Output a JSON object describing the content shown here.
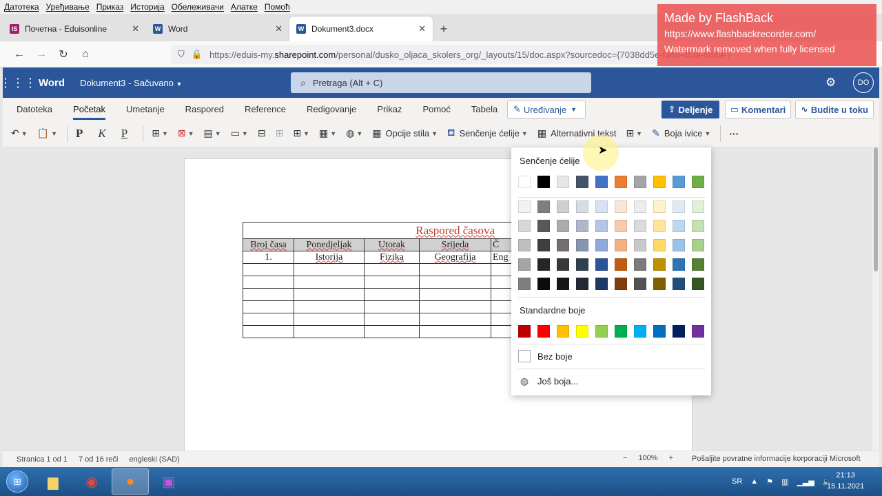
{
  "menubar": [
    "Датотека",
    "Уређивање",
    "Приказ",
    "Историја",
    "Обележивачи",
    "Алатке",
    "Помоћ"
  ],
  "tabs": [
    {
      "label": "Почетна - Eduisonline",
      "icon": "IS",
      "color": "#a0206e"
    },
    {
      "label": "Word",
      "icon": "W",
      "color": "#2b579a"
    },
    {
      "label": "Dokument3.docx",
      "icon": "W",
      "color": "#2b579a"
    }
  ],
  "url": {
    "prefix": "https://eduis-my.",
    "host": "sharepoint.com",
    "path": "/personal/dusko_oljaca_skolers_org/_layouts/15/doc.aspx?sourcedoc={7038dd5e-f348-4f39-8849-7"
  },
  "watermark": {
    "line1": "Made by FlashBack",
    "line2": "https://www.flashbackrecorder.com/",
    "line3": "Watermark removed when fully licensed"
  },
  "word": {
    "app": "Word",
    "doc": "Dokument3 - Sačuvano",
    "search_placeholder": "Pretraga (Alt + C)",
    "avatar": "DO"
  },
  "ribbon": {
    "tabs": [
      "Datoteka",
      "Početak",
      "Umetanje",
      "Raspored",
      "Reference",
      "Redigovanje",
      "Prikaz",
      "Pomoć",
      "Tabela"
    ],
    "edit": "Uređivanje",
    "share": "Deljenje",
    "comments": "Komentari",
    "catchup": "Budite u toku"
  },
  "toolbar": {
    "bold": "P",
    "italic": "K",
    "underline": "P",
    "style_options": "Opcije stila",
    "cell_shading": "Senčenje ćelije",
    "alt_text": "Alternativni tekst",
    "border_color": "Boja ivice"
  },
  "table": {
    "title": "Raspored časova",
    "headers": [
      "Broj časa",
      "Ponedjeljak",
      "Utorak",
      "Srijeda",
      "Č"
    ],
    "row1": [
      "1.",
      "Istorija",
      "Fizika",
      "Geografija",
      "Eng"
    ]
  },
  "shading": {
    "title": "Senčenje ćelije",
    "theme_row": [
      "#ffffff",
      "#000000",
      "#e7e6e6",
      "#44546a",
      "#4472c4",
      "#ed7d31",
      "#a5a5a5",
      "#ffc000",
      "#5b9bd5",
      "#70ad47"
    ],
    "tints": [
      [
        "#f2f2f2",
        "#7f7f7f",
        "#d0cece",
        "#d6dce4",
        "#d9e2f3",
        "#fbe5d5",
        "#ededed",
        "#fff2cc",
        "#deebf6",
        "#e2efd9"
      ],
      [
        "#d8d8d8",
        "#595959",
        "#aeabab",
        "#adb9ca",
        "#b4c6e7",
        "#f7caac",
        "#dbdbdb",
        "#fee599",
        "#bdd7ee",
        "#c5e0b3"
      ],
      [
        "#bfbfbf",
        "#3f3f3f",
        "#757070",
        "#8496b0",
        "#8eaadb",
        "#f4b083",
        "#c9c9c9",
        "#ffd965",
        "#9cc3e5",
        "#a8d08d"
      ],
      [
        "#a5a5a5",
        "#262626",
        "#3a3838",
        "#323f4f",
        "#2f5496",
        "#c45911",
        "#7b7b7b",
        "#bf9000",
        "#2e75b5",
        "#538135"
      ],
      [
        "#7f7f7f",
        "#0c0c0c",
        "#171616",
        "#222a35",
        "#1f3864",
        "#833c0b",
        "#525252",
        "#7f6000",
        "#1e4e79",
        "#375623"
      ]
    ],
    "standard_label": "Standardne boje",
    "standard": [
      "#c00000",
      "#ff0000",
      "#ffc000",
      "#ffff00",
      "#92d050",
      "#00b050",
      "#00b0f0",
      "#0070c0",
      "#002060",
      "#7030a0"
    ],
    "no_color": "Bez boje",
    "more_colors": "Još boja..."
  },
  "status": {
    "page": "Stranica 1 od 1",
    "words": "7 od 16 reči",
    "lang": "engleski (SAD)",
    "zoom": "100%",
    "feedback": "Pošaljite povratne informacije korporaciji Microsoft"
  },
  "tray": {
    "lang": "SR",
    "time": "21:13",
    "date": "15.11.2021"
  }
}
